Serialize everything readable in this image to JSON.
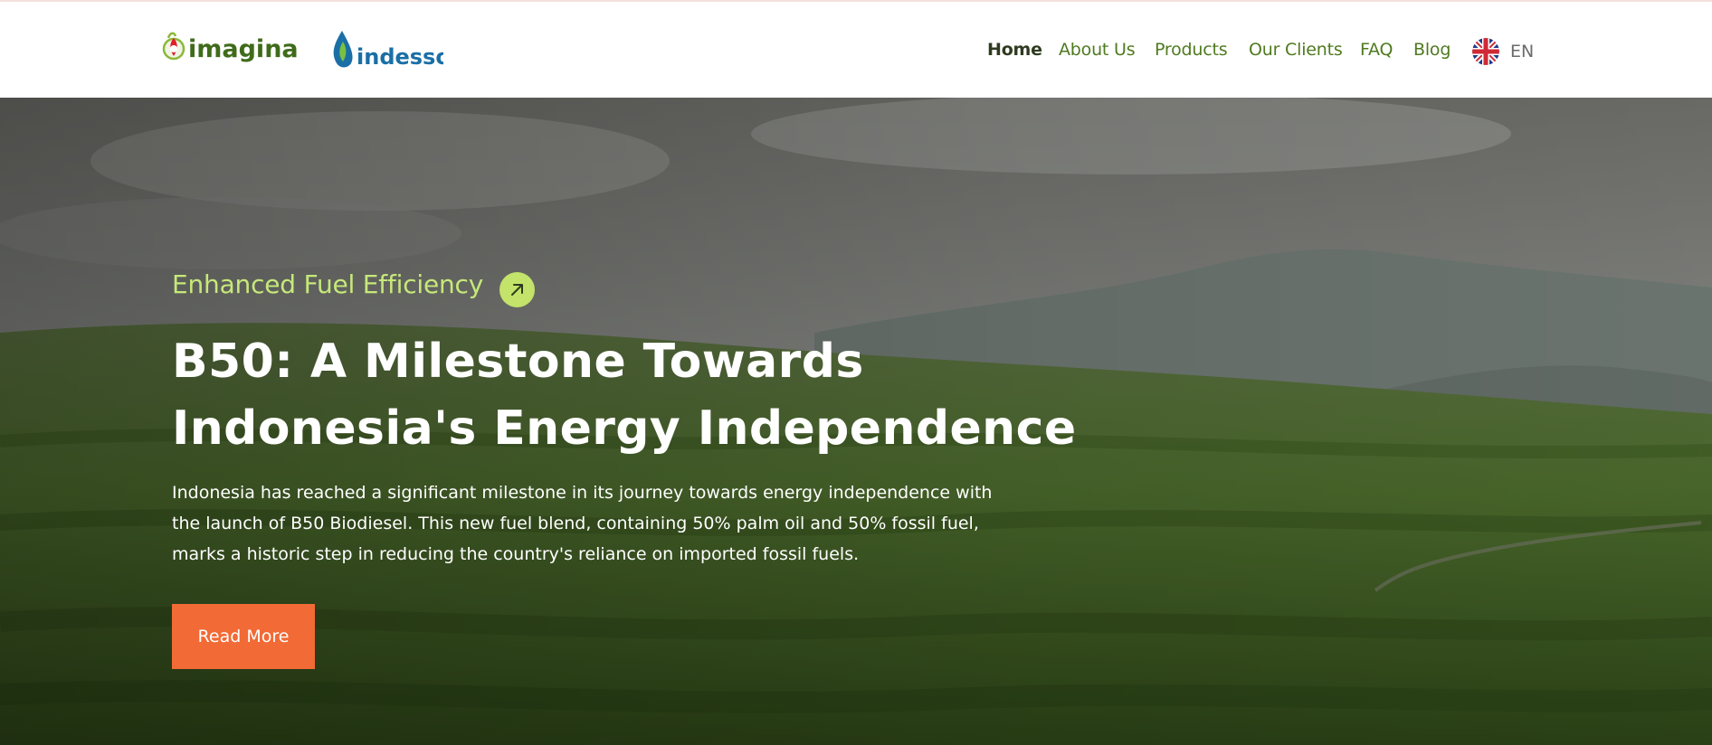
{
  "brand": {
    "logo_imagina": "imagina",
    "logo_indesso": "indesso",
    "colors": {
      "accent_green": "#4f7a1f",
      "kicker_green": "#c6e87a",
      "cta_orange": "#f26a35",
      "indesso_blue": "#1a6fa6"
    }
  },
  "nav": {
    "items": [
      {
        "label": "Home",
        "active": true
      },
      {
        "label": "About Us",
        "active": false
      },
      {
        "label": "Products",
        "active": false
      },
      {
        "label": "Our Clients",
        "active": false
      },
      {
        "label": "FAQ",
        "active": false
      },
      {
        "label": "Blog",
        "active": false
      }
    ],
    "language": {
      "label": "EN",
      "icon": "uk-flag-icon"
    }
  },
  "hero": {
    "kicker": "Enhanced Fuel Efficiency",
    "kicker_icon": "arrow-up-right-icon",
    "title_line1": "B50: A Milestone Towards",
    "title_line2": "Indonesia's Energy Independence",
    "desc_line1": "Indonesia has reached a significant milestone in its journey towards energy independence with",
    "desc_line2": "the launch of B50 Biodiesel. This new fuel blend, containing 50% palm oil and 50% fossil fuel,",
    "desc_line3": "marks a historic step in reducing the country's reliance on imported fossil fuels.",
    "cta_label": "Read More"
  }
}
